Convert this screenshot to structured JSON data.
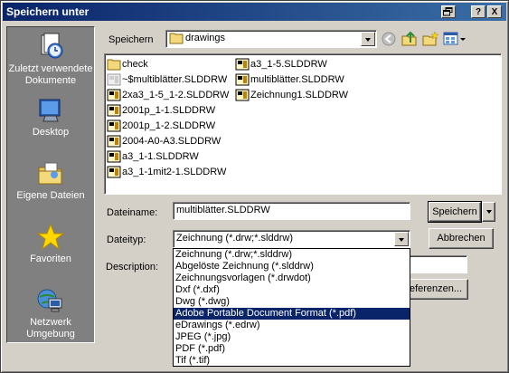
{
  "window": {
    "title": "Speichern unter",
    "help_btn": "?",
    "close_btn": "X"
  },
  "places": [
    {
      "label": "Zuletzt verwendete Dokumente",
      "icon": "recent-documents-icon"
    },
    {
      "label": "Desktop",
      "icon": "desktop-icon"
    },
    {
      "label": "Eigene Dateien",
      "icon": "my-documents-icon"
    },
    {
      "label": "Favoriten",
      "icon": "favorites-icon"
    },
    {
      "label": "Netzwerk Umgebung",
      "icon": "network-icon"
    }
  ],
  "location": {
    "label": "Speichern",
    "value": "drawings"
  },
  "files": [
    {
      "name": "check",
      "type": "folder"
    },
    {
      "name": "~$multiblätter.SLDDRW",
      "type": "temp-drawing"
    },
    {
      "name": "2xa3_1-5_1-2.SLDDRW",
      "type": "drawing"
    },
    {
      "name": "2001p_1-1.SLDDRW",
      "type": "drawing"
    },
    {
      "name": "2001p_1-2.SLDDRW",
      "type": "drawing"
    },
    {
      "name": "2004-A0-A3.SLDDRW",
      "type": "drawing"
    },
    {
      "name": "a3_1-1.SLDDRW",
      "type": "drawing"
    },
    {
      "name": "a3_1-1mit2-1.SLDDRW",
      "type": "drawing"
    },
    {
      "name": "a3_1-5.SLDDRW",
      "type": "drawing"
    },
    {
      "name": "multiblätter.SLDDRW",
      "type": "drawing"
    },
    {
      "name": "Zeichnung1.SLDDRW",
      "type": "drawing"
    }
  ],
  "filename": {
    "label": "Dateiname:",
    "value": "multiblätter.SLDDRW"
  },
  "filetype": {
    "label": "Dateityp:",
    "value": "Zeichnung (*.drw;*.slddrw)",
    "options": [
      "Zeichnung (*.drw;*.slddrw)",
      "Abgelöste Zeichnung (*.slddrw)",
      "Zeichnungsvorlagen (*.drwdot)",
      "Dxf (*.dxf)",
      "Dwg (*.dwg)",
      "Adobe Portable Document Format (*.pdf)",
      "eDrawings (*.edrw)",
      "JPEG (*.jpg)",
      "PDF (*.pdf)",
      "Tif (*.tif)"
    ],
    "highlighted_index": 5
  },
  "description": {
    "label": "Description:"
  },
  "buttons": {
    "save": "Speichern",
    "cancel": "Abbrechen",
    "references": "eferenzen..."
  }
}
